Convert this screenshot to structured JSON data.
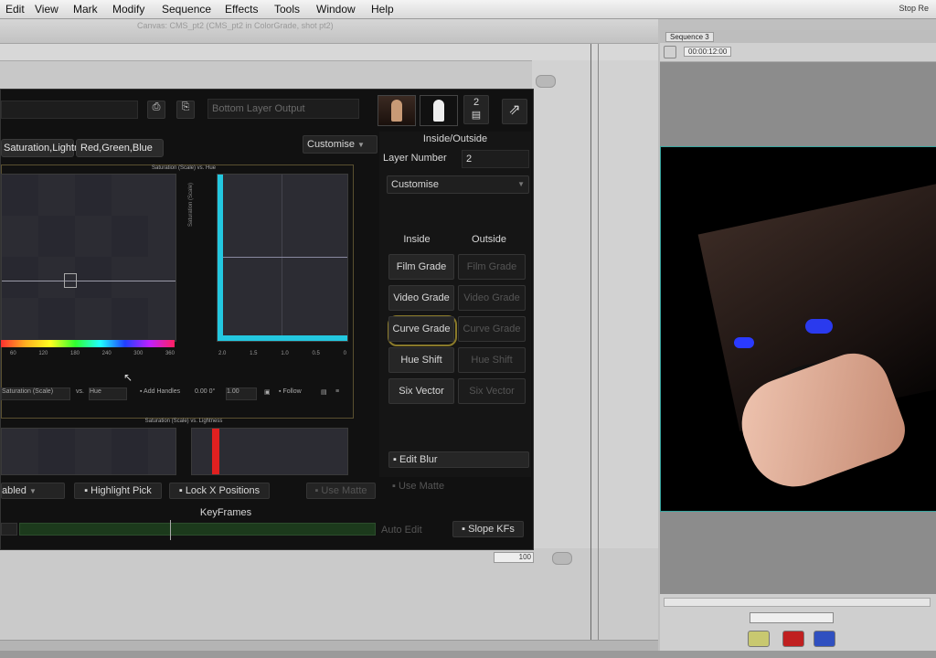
{
  "menu": [
    "Edit",
    "View",
    "Mark",
    "Modify",
    "Sequence",
    "Effects",
    "Tools",
    "Window",
    "Help"
  ],
  "menu_right": "Stop Re",
  "host": {
    "title": "Canvas: CMS_pt2 (CMS_pt2 in ColorGrade, shot pt2)",
    "sequence_tab": "Sequence 3",
    "timecode": "00:00:12:00",
    "zoom_value": "100"
  },
  "plugin": {
    "layer_output_placeholder": "Bottom Layer Output",
    "layer_count": "2",
    "inside_outside_title": "Inside/Outside",
    "layer_number_label": "Layer Number",
    "layer_number_value": "2",
    "customise_menu": "Customise",
    "customise_top": "Customise",
    "tab_hsl": "Saturation,Lightness",
    "tab_rgb": "Red,Green,Blue",
    "col_inside": "Inside",
    "col_outside": "Outside",
    "grades": [
      {
        "inside": "Film Grade",
        "outside": "Film Grade"
      },
      {
        "inside": "Video Grade",
        "outside": "Video Grade"
      },
      {
        "inside": "Curve Grade",
        "outside": "Curve Grade"
      },
      {
        "inside": "Hue Shift",
        "outside": "Hue Shift"
      },
      {
        "inside": "Six Vector",
        "outside": "Six Vector"
      }
    ],
    "edit_blur": "Edit Blur",
    "use_matte": "Use Matte",
    "graph1_title": "Saturation (Scale) vs. Hue",
    "graph2_title": "Saturation (Scale) vs. Lightness",
    "graph_ylabel": "Saturation (Scale)",
    "graph_toolbar": {
      "curve_select": "Saturation (Scale)",
      "vs": "vs.",
      "axis_select": "Hue",
      "add_handles": "Add Handles",
      "handle_value": "0.00 0°",
      "scale_value": "1.00",
      "follow": "Follow"
    },
    "bottom_enabled": "abled",
    "highlight_pick": "Highlight Pick",
    "lock_x_positions": "Lock X Positions",
    "use_matte_bottom": "Use Matte",
    "keyframes_label": "KeyFrames",
    "auto_edit": "Auto Edit",
    "slope_kfs": "Slope KFs"
  },
  "colors": {
    "accent_cyan": "#23c8e0",
    "accent_red": "#e02020",
    "selection_ring": "#8a7a2a",
    "viewer_border": "#3aa6a0"
  }
}
